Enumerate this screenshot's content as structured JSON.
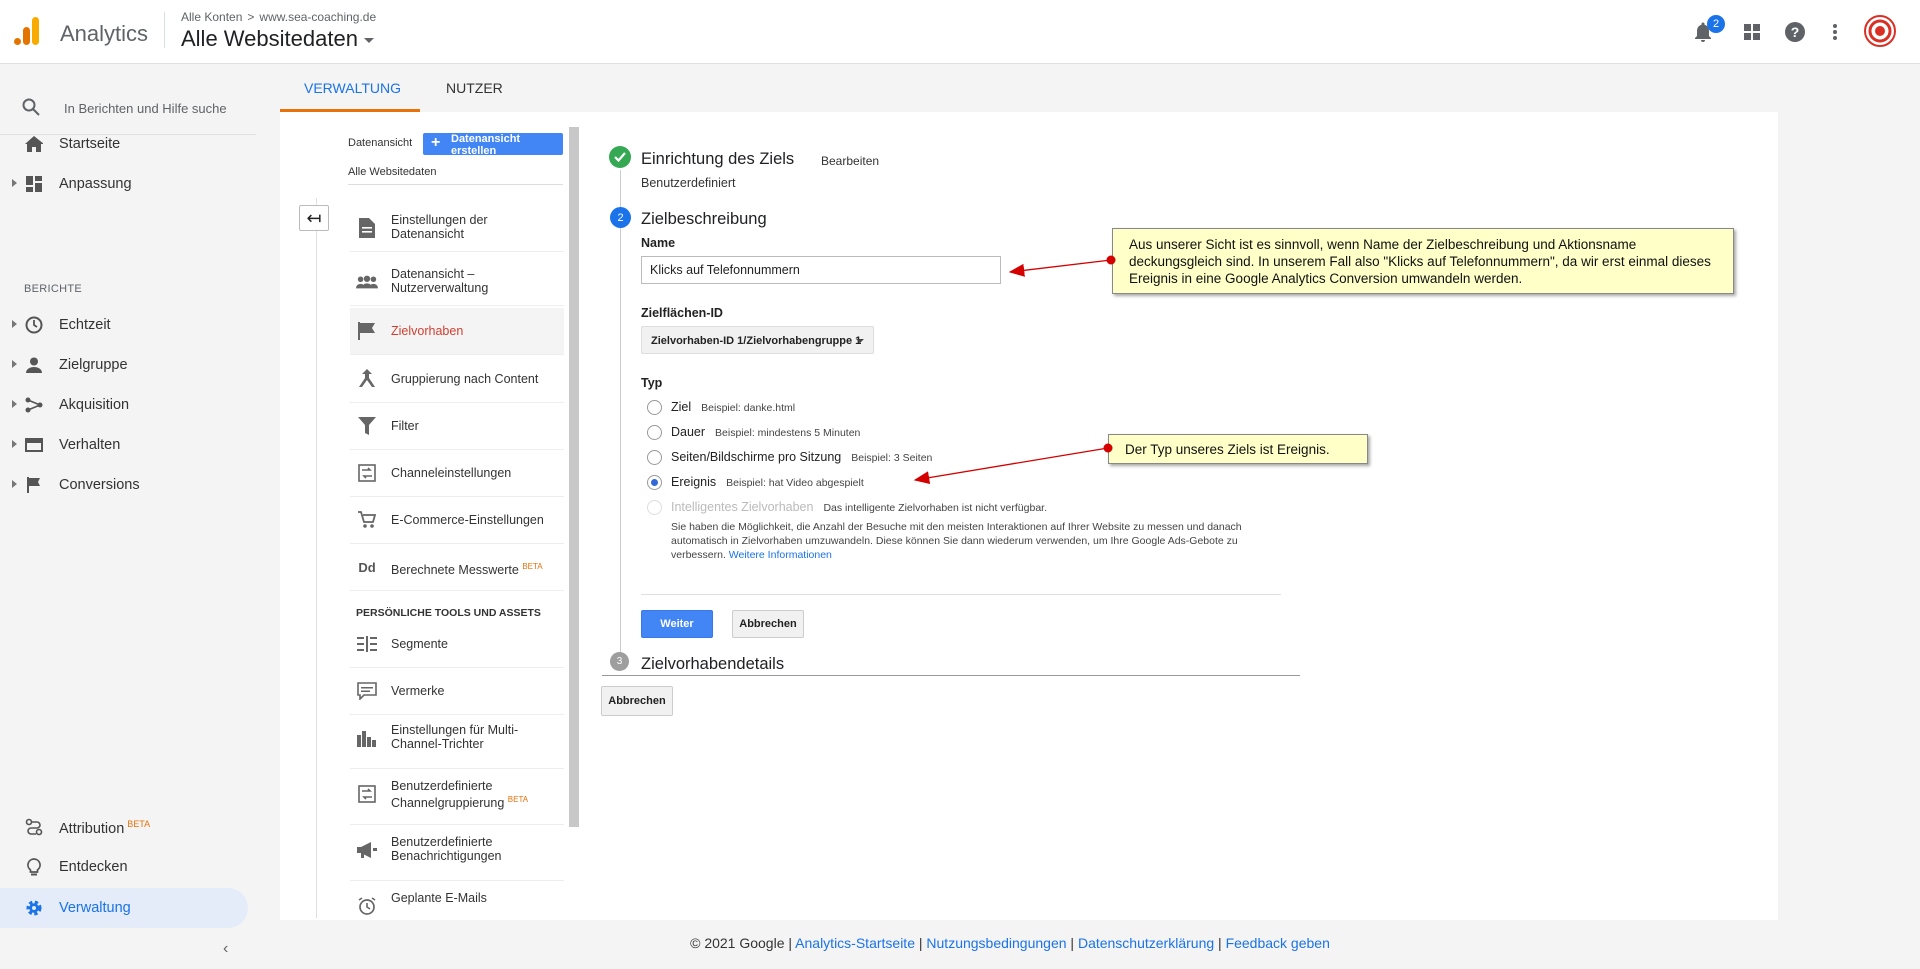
{
  "header": {
    "app_title": "Analytics",
    "breadcrumb_all": "Alle Konten",
    "breadcrumb_site": "www.sea-coaching.de",
    "property": "Alle Websitedaten",
    "notification_count": "2"
  },
  "sidebar": {
    "search_placeholder": "In Berichten und Hilfe suche",
    "startseite": "Startseite",
    "anpassung": "Anpassung",
    "berichte_header": "BERICHTE",
    "echtzeit": "Echtzeit",
    "zielgruppe": "Zielgruppe",
    "akquisition": "Akquisition",
    "verhalten": "Verhalten",
    "conversions": "Conversions",
    "attribution": "Attribution",
    "attribution_badge": "BETA",
    "entdecken": "Entdecken",
    "verwaltung": "Verwaltung"
  },
  "tabs": {
    "verwaltung": "VERWALTUNG",
    "nutzer": "NUTZER"
  },
  "view_panel": {
    "label": "Datenansicht",
    "create_button": "Datenansicht erstellen",
    "view_name": "Alle Websitedaten",
    "items": {
      "einstellungen": "Einstellungen der Datenansicht",
      "nutzerverwaltung": "Datenansicht – Nutzerverwaltung",
      "zielvorhaben": "Zielvorhaben",
      "gruppierung": "Gruppierung nach Content",
      "filter": "Filter",
      "channel": "Channeleinstellungen",
      "ecommerce": "E-Commerce-Einstellungen",
      "berechnete": "Berechnete Messwerte",
      "berechnete_badge": "BETA",
      "segmente": "Segmente",
      "vermerke": "Vermerke",
      "multichannel": "Einstellungen für Multi-Channel-Trichter",
      "channelgruppierung": "Benutzerdefinierte Channelgruppierung",
      "channelgruppierung_badge": "BETA",
      "benachrichtigungen": "Benutzerdefinierte Benachrichtigungen",
      "emails": "Geplante E-Mails"
    },
    "personal_header": "PERSÖNLICHE TOOLS UND ASSETS"
  },
  "form": {
    "step1_title": "Einrichtung des Ziels",
    "step1_edit": "Bearbeiten",
    "step1_subtitle": "Benutzerdefiniert",
    "step2_number": "2",
    "step2_title": "Zielbeschreibung",
    "name_label": "Name",
    "name_value": "Klicks auf Telefonnummern",
    "zielflaechen_label": "Zielflächen-ID",
    "zielflaechen_value": "Zielvorhaben-ID 1/Zielvorhabengruppe 1",
    "typ_label": "Typ",
    "types": {
      "ziel": "Ziel",
      "ziel_example": "Beispiel: danke.html",
      "dauer": "Dauer",
      "dauer_example": "Beispiel: mindestens 5 Minuten",
      "seiten": "Seiten/Bildschirme pro Sitzung",
      "seiten_example": "Beispiel: 3 Seiten",
      "ereignis": "Ereignis",
      "ereignis_example": "Beispiel: hat Video abgespielt",
      "smart": "Intelligentes Zielvorhaben",
      "smart_note": "Das intelligente Zielvorhaben ist nicht verfügbar."
    },
    "smart_info": "Sie haben die Möglichkeit, die Anzahl der Besuche mit den meisten Interaktionen auf Ihrer Website zu messen und danach automatisch in Zielvorhaben umzuwandeln. Diese können Sie dann wiederum verwenden, um Ihre Google Ads-Gebote zu verbessern.",
    "smart_info_link": "Weitere Informationen",
    "weiter_button": "Weiter",
    "abbrechen_button": "Abbrechen",
    "step3_number": "3",
    "step3_title": "Zielvorhabendetails",
    "abbrechen_main": "Abbrechen"
  },
  "callouts": {
    "name_note": "Aus unserer Sicht ist es sinnvoll, wenn Name der Zielbeschreibung und Aktionsname deckungsgleich sind. In unserem Fall also \"Klicks auf Telefonnummern\", da wir erst einmal dieses Ereignis in eine Google Analytics Conversion umwandeln werden.",
    "type_note": "Der Typ unseres Ziels ist Ereignis."
  },
  "footer": {
    "copyright": "© 2021 Google",
    "link_home": "Analytics-Startseite",
    "link_terms": "Nutzungsbedingungen",
    "link_privacy": "Datenschutzerklärung",
    "link_feedback": "Feedback geben"
  },
  "colors": {
    "accent_blue": "#1a73e8",
    "tab_underline": "#e8710a",
    "active_item_red": "#d23f31",
    "callout_bg": "#ffffc8"
  }
}
